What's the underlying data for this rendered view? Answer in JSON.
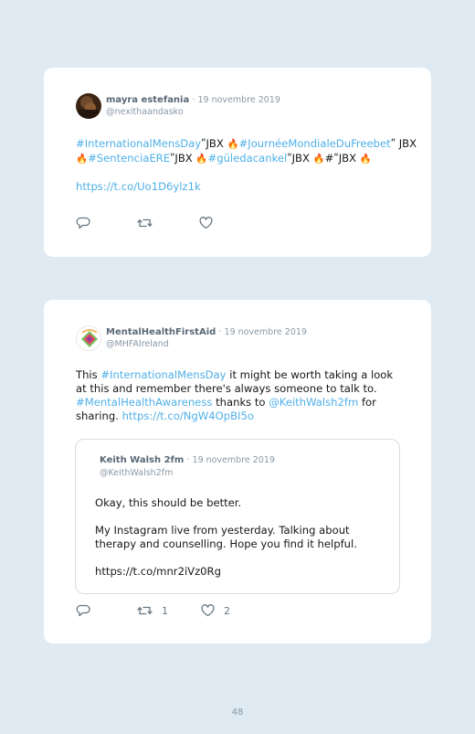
{
  "tweets": [
    {
      "author_name": "mayra estefania",
      "date": "· 19 novembre 2019",
      "handle": "@nexithaandasko",
      "body": [
        {
          "t": "#InternationalMensDay",
          "link": true
        },
        {
          "t": "ʺJBX ",
          "link": false
        },
        {
          "t": "🔥",
          "link": false,
          "emoji": true
        },
        {
          "t": "#JournéeMondialeDuFreebet",
          "link": true
        },
        {
          "t": "ʺ JBX ",
          "link": false
        },
        {
          "t": "🔥",
          "link": false,
          "emoji": true
        },
        {
          "t": "#SentenciaERE",
          "link": true
        },
        {
          "t": "ʺJBX ",
          "link": false
        },
        {
          "t": "🔥",
          "link": false,
          "emoji": true
        },
        {
          "t": "#güledacankel",
          "link": true
        },
        {
          "t": "ʺJBX ",
          "link": false
        },
        {
          "t": "🔥",
          "link": false,
          "emoji": true
        },
        {
          "t": "#ʺJBX ",
          "link": false
        },
        {
          "t": "🔥",
          "link": false,
          "emoji": true
        }
      ],
      "link": "https://t.co/Uo1D6ylz1k",
      "actions": {
        "reply_count": "",
        "retweet_count": "",
        "like_count": ""
      }
    },
    {
      "author_name": "MentalHealthFirstAid",
      "date": "· 19 novembre 2019",
      "handle": "@MHFAIreland",
      "body": [
        {
          "t": "This ",
          "link": false
        },
        {
          "t": "#InternationalMensDay",
          "link": true
        },
        {
          "t": " it might be worth taking a look at this and remember there's always someone to talk to. ",
          "link": false
        },
        {
          "t": "#MentalHealthAwareness",
          "link": true
        },
        {
          "t": " thanks to ",
          "link": false
        },
        {
          "t": "@KeithWalsh2fm",
          "link": true
        },
        {
          "t": " for sharing. ",
          "link": false
        },
        {
          "t": "https://t.co/NgW4OpBI5o",
          "link": true
        }
      ],
      "quote": {
        "author_name": "Keith Walsh 2fm",
        "date": "· 19 novembre 2019",
        "handle": "@KeithWalsh2fm",
        "line1": "Okay, this should be better.",
        "line2": "My Instagram live from yesterday. Talking about therapy and counselling. Hope you find it helpful.",
        "link": "https://t.co/mnr2iVz0Rg"
      },
      "actions": {
        "reply_count": "",
        "retweet_count": "1",
        "like_count": "2"
      }
    }
  ],
  "page_number": "48",
  "colors": {
    "background": "#dfeaf3",
    "card": "#ffffff",
    "link": "#4fb0e8",
    "muted": "#8a98a5",
    "name": "#5a6875"
  },
  "icons": [
    "reply-icon",
    "retweet-icon",
    "like-icon"
  ]
}
